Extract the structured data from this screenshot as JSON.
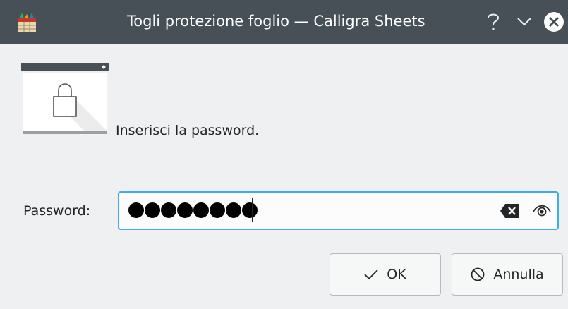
{
  "window": {
    "title": "Togli protezione foglio — Calligra Sheets",
    "icons": {
      "app": "calligra-sheets-icon",
      "help": "help-icon",
      "minimize": "chevron-down-icon",
      "close": "close-icon"
    }
  },
  "dialog": {
    "message": "Inserisci la password.",
    "illustration_icon": "lock-icon",
    "password": {
      "label": "Password:",
      "masked_length": 8,
      "clear_icon": "clear-text-icon",
      "reveal_icon": "eye-icon"
    },
    "buttons": {
      "ok_label": "OK",
      "ok_icon": "checkmark-icon",
      "cancel_label": "Annulla",
      "cancel_icon": "cancel-icon"
    }
  },
  "colors": {
    "titlebar": "#475057",
    "window_bg": "#eff0f1",
    "focus": "#3daee9",
    "text": "#232629"
  }
}
